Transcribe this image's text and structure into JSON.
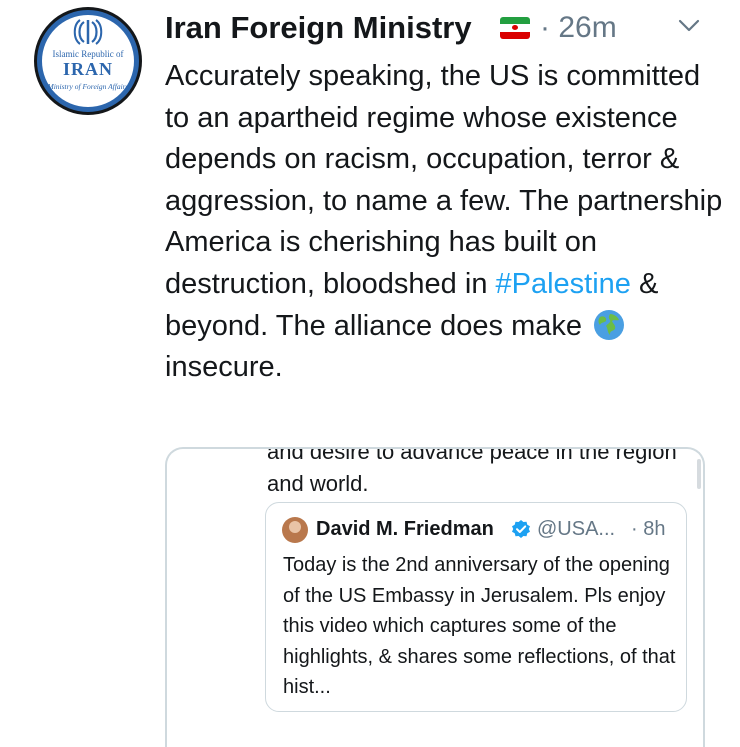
{
  "avatar": {
    "line1": "Islamic Republic of",
    "line2": "IRAN",
    "line3": "Ministry of Foreign Affairs"
  },
  "tweet": {
    "author_name": "Iran Foreign Ministry",
    "separator": "·",
    "time": "26m",
    "flag_icon": "iran-flag-emoji",
    "menu_icon": "chevron-down-icon",
    "text_part1": "Accurately speaking, the US is committed to an apartheid regime whose existence depends on racism, occupation, terror & aggression, to name a few. The partnership America is cherishing has built on destruction, bloodshed in ",
    "hashtag": "#Palestine",
    "text_part2": " & beyond. The alliance does make ",
    "globe_icon": "globe-emoji",
    "text_part3": " insecure."
  },
  "embedded": {
    "clipped_line": "and desire to advance peace in the region",
    "line2": "and world.",
    "quote": {
      "author_name": "David M. Friedman",
      "handle": "@USA...",
      "time": "· 8h",
      "text": "Today is the 2nd anniversary of the opening of the US Embassy in Jerusalem. Pls enjoy this video which captures some of the highlights, & shares some reflections, of that hist..."
    }
  },
  "colors": {
    "link": "#1da1f2",
    "secondary": "#657786",
    "border": "#cfd9de",
    "avatar_blue": "#2c66ad"
  }
}
